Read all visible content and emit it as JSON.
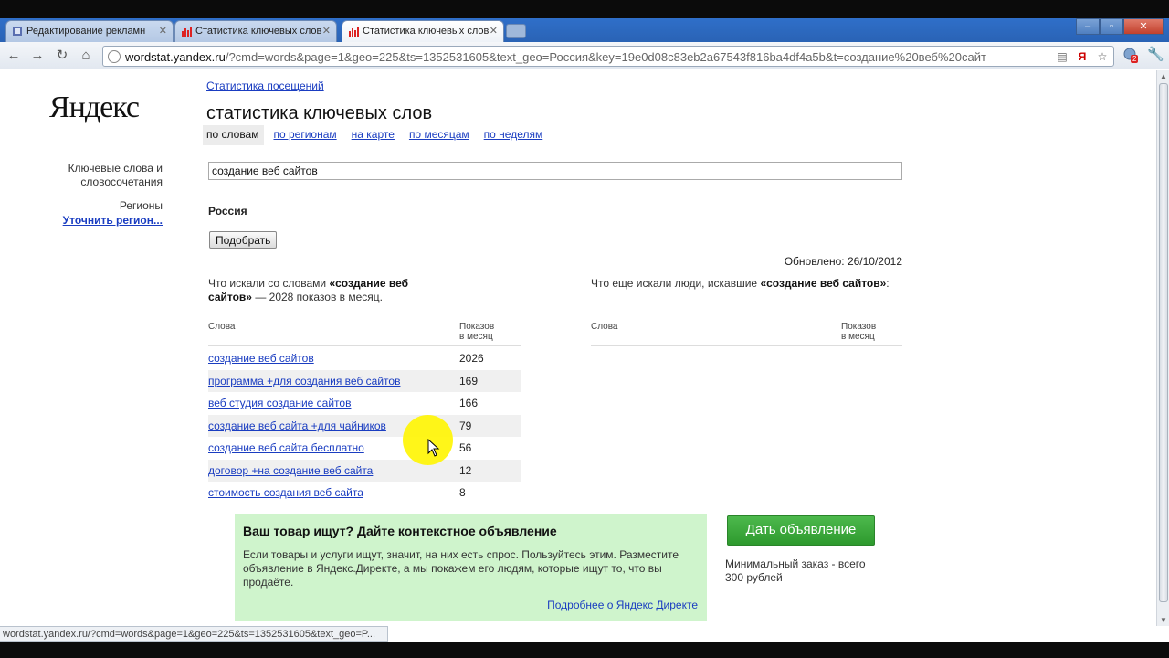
{
  "browser": {
    "tabs": [
      {
        "title": "Редактирование рекламн",
        "active": false
      },
      {
        "title": "Статистика ключевых слов",
        "active": false
      },
      {
        "title": "Статистика ключевых слов",
        "active": true
      }
    ],
    "url_host": "wordstat.yandex.ru",
    "url_rest": "/?cmd=words&page=1&geo=225&ts=1352531605&text_geo=Россия&key=19e0d08c83eb2a67543f816ba4df4a5b&t=создание%20веб%20сайт",
    "extension_badge": "2",
    "status_text": "wordstat.yandex.ru/?cmd=words&page=1&geo=225&ts=1352531605&text_geo=P..."
  },
  "header": {
    "logo": "Яндекс",
    "visits_link": "Статистика посещений",
    "title": "статистика ключевых слов",
    "nav": [
      "по словам",
      "по регионам",
      "на карте",
      "по месяцам",
      "по неделям"
    ]
  },
  "sidebar": {
    "keywords_label": "Ключевые слова и словосочетания",
    "regions_label": "Регионы",
    "refine_region_link": "Уточнить регион..."
  },
  "search": {
    "value": "создание веб сайтов",
    "region": "Россия",
    "submit_label": "Подобрать",
    "updated": "Обновлено: 26/10/2012"
  },
  "left_table": {
    "intro_prefix": "Что искали со словами ",
    "intro_bold": "«создание веб сайтов»",
    "intro_suffix": " — 2028 показов в месяц.",
    "col_words": "Слова",
    "col_shows_1": "Показов",
    "col_shows_2": "в месяц",
    "rows": [
      {
        "word": "создание веб сайтов",
        "count": "2026"
      },
      {
        "word": "программа +для создания веб сайтов",
        "count": "169"
      },
      {
        "word": "веб студия создание сайтов",
        "count": "166"
      },
      {
        "word": "создание веб сайта +для чайников",
        "count": "79"
      },
      {
        "word": "создание веб сайта бесплатно",
        "count": "56"
      },
      {
        "word": "договор +на создание веб сайта",
        "count": "12"
      },
      {
        "word": "стоимость создания веб сайта",
        "count": "8"
      }
    ]
  },
  "right_table": {
    "intro_prefix": "Что еще искали люди, искавшие ",
    "intro_bold": "«создание веб сайтов»",
    "intro_suffix": ":",
    "col_words": "Слова",
    "col_shows_1": "Показов",
    "col_shows_2": "в месяц"
  },
  "ad": {
    "title": "Ваш товар ищут? Дайте контекстное объявление",
    "text": "Если товары и услуги ищут, значит, на них есть спрос. Пользуйтесь этим. Разместите объявление в Яндекс.Директе, а мы покажем его людям, которые ищут то, что вы продаёте.",
    "more_link": "Подробнее о Яндекс Директе",
    "button": "Дать объявление",
    "note": "Минимальный заказ - всего 300 рублей"
  }
}
